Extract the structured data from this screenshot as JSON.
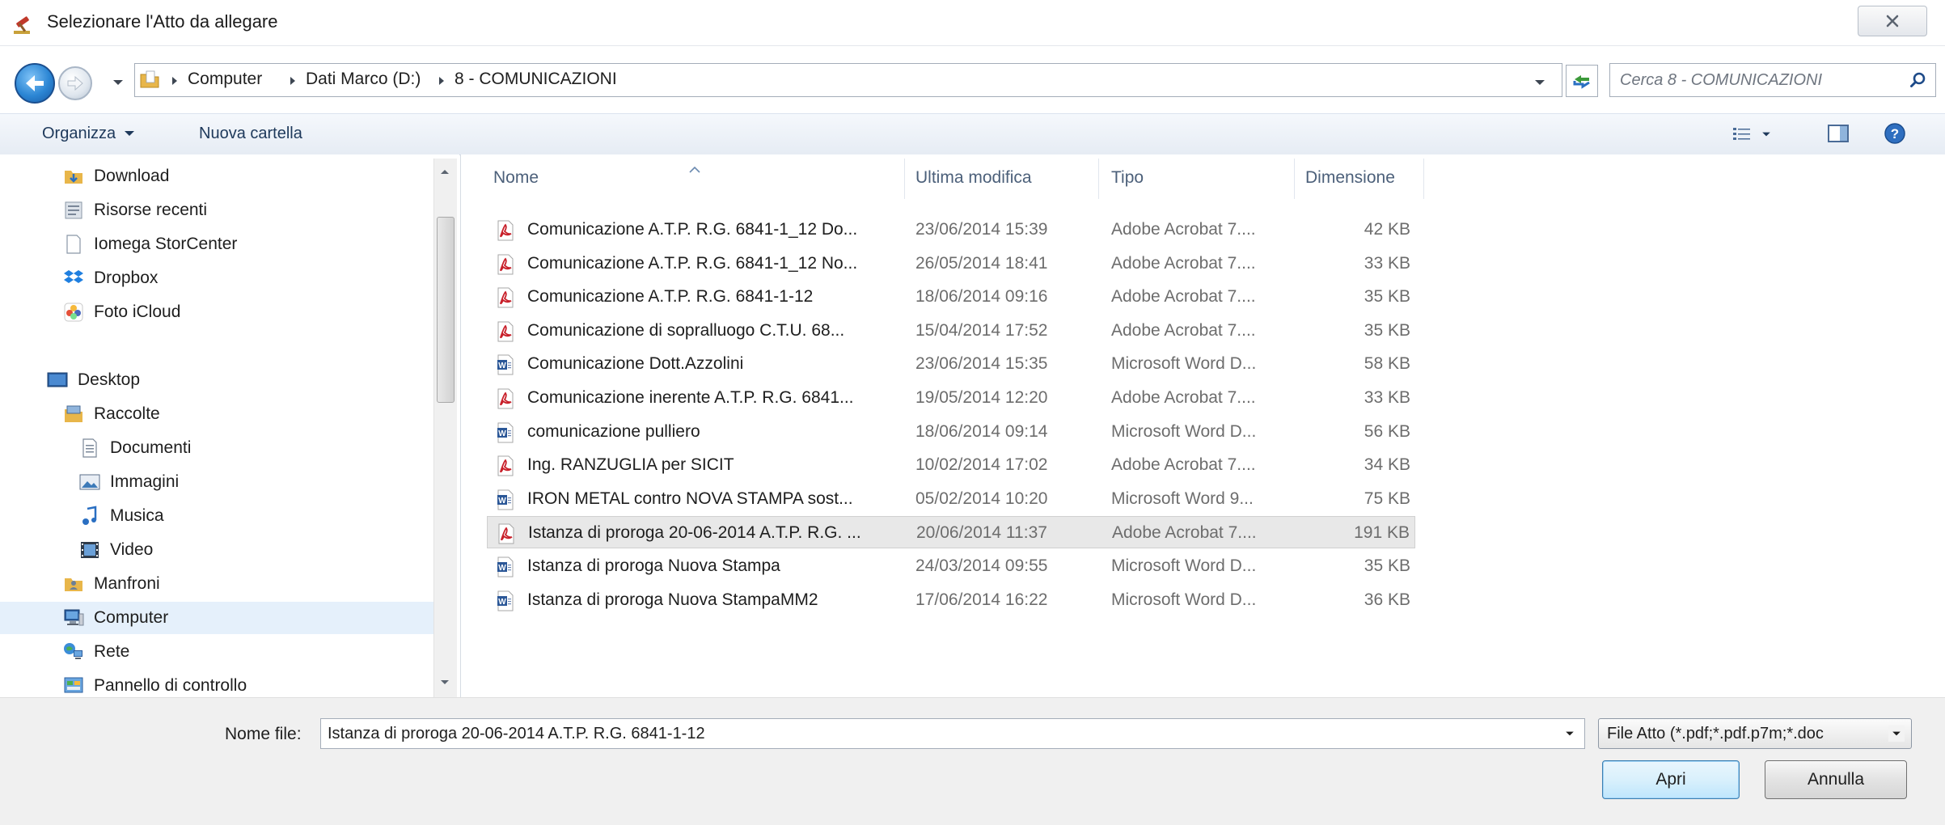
{
  "window": {
    "title": "Selezionare l'Atto da allegare",
    "close_label": "✕"
  },
  "address": {
    "breadcrumbs": [
      "Computer",
      "Dati Marco (D:)",
      "8 - COMUNICAZIONI"
    ]
  },
  "search": {
    "placeholder": "Cerca 8 - COMUNICAZIONI"
  },
  "toolbar": {
    "organize_label": "Organizza",
    "new_folder_label": "Nuova cartella"
  },
  "nav": {
    "items": [
      {
        "label": "Download",
        "icon": "download-folder-icon"
      },
      {
        "label": "Risorse recenti",
        "icon": "recent-places-icon"
      },
      {
        "label": "Iomega StorCenter",
        "icon": "blank-document-icon"
      },
      {
        "label": "Dropbox",
        "icon": "dropbox-icon"
      },
      {
        "label": "Foto iCloud",
        "icon": "icloud-photos-icon"
      },
      {
        "label": "Desktop",
        "icon": "desktop-icon"
      },
      {
        "label": "Raccolte",
        "icon": "libraries-icon"
      },
      {
        "label": "Documenti",
        "icon": "documents-library-icon"
      },
      {
        "label": "Immagini",
        "icon": "pictures-library-icon"
      },
      {
        "label": "Musica",
        "icon": "music-library-icon"
      },
      {
        "label": "Video",
        "icon": "video-library-icon"
      },
      {
        "label": "Manfroni",
        "icon": "user-folder-icon"
      },
      {
        "label": "Computer",
        "icon": "computer-icon",
        "selected": true
      },
      {
        "label": "Rete",
        "icon": "network-icon"
      },
      {
        "label": "Pannello di controllo",
        "icon": "control-panel-icon"
      }
    ]
  },
  "columns": {
    "name": "Nome",
    "modified": "Ultima modifica",
    "type": "Tipo",
    "size": "Dimensione"
  },
  "files": [
    {
      "name": "Comunicazione A.T.P. R.G. 6841-1_12 Do...",
      "modified": "23/06/2014 15:39",
      "type": "Adobe Acrobat 7....",
      "size": "42 KB",
      "icon": "pdf-file-icon"
    },
    {
      "name": "Comunicazione A.T.P. R.G. 6841-1_12 No...",
      "modified": "26/05/2014 18:41",
      "type": "Adobe Acrobat 7....",
      "size": "33 KB",
      "icon": "pdf-file-icon"
    },
    {
      "name": "Comunicazione A.T.P. R.G. 6841-1-12",
      "modified": "18/06/2014 09:16",
      "type": "Adobe Acrobat 7....",
      "size": "35 KB",
      "icon": "pdf-file-icon"
    },
    {
      "name": "Comunicazione di sopralluogo C.T.U. 68...",
      "modified": "15/04/2014 17:52",
      "type": "Adobe Acrobat 7....",
      "size": "35 KB",
      "icon": "pdf-file-icon"
    },
    {
      "name": "Comunicazione Dott.Azzolini",
      "modified": "23/06/2014 15:35",
      "type": "Microsoft Word D...",
      "size": "58 KB",
      "icon": "word-file-icon"
    },
    {
      "name": "Comunicazione inerente A.T.P. R.G. 6841...",
      "modified": "19/05/2014 12:20",
      "type": "Adobe Acrobat 7....",
      "size": "33 KB",
      "icon": "pdf-file-icon"
    },
    {
      "name": "comunicazione pulliero",
      "modified": "18/06/2014 09:14",
      "type": "Microsoft Word D...",
      "size": "56 KB",
      "icon": "word-file-icon"
    },
    {
      "name": "Ing. RANZUGLIA per SICIT",
      "modified": "10/02/2014 17:02",
      "type": "Adobe Acrobat 7....",
      "size": "34 KB",
      "icon": "pdf-file-icon"
    },
    {
      "name": "IRON METAL contro NOVA STAMPA sost...",
      "modified": "05/02/2014 10:20",
      "type": "Microsoft Word 9...",
      "size": "75 KB",
      "icon": "word-file-icon"
    },
    {
      "name": "Istanza di proroga 20-06-2014 A.T.P. R.G. ...",
      "modified": "20/06/2014 11:37",
      "type": "Adobe Acrobat 7....",
      "size": "191 KB",
      "icon": "pdf-file-icon",
      "selected": true
    },
    {
      "name": "Istanza di proroga Nuova Stampa",
      "modified": "24/03/2014 09:55",
      "type": "Microsoft Word D...",
      "size": "35 KB",
      "icon": "word-file-icon"
    },
    {
      "name": "Istanza di proroga Nuova StampaMM2",
      "modified": "17/06/2014 16:22",
      "type": "Microsoft Word D...",
      "size": "36 KB",
      "icon": "word-file-icon"
    }
  ],
  "bottom": {
    "filename_label": "Nome file:",
    "filename_value": "Istanza di proroga 20-06-2014 A.T.P. R.G. 6841-1-12",
    "filetype_label": "File Atto (*.pdf;*.pdf.p7m;*.doc",
    "open_label": "Apri",
    "cancel_label": "Annulla"
  },
  "colors": {
    "accent": "#2c86d4",
    "selection": "#e5f0fb",
    "header_text": "#4c607a",
    "pdf_red": "#c8202a",
    "word_blue": "#2b5797"
  }
}
